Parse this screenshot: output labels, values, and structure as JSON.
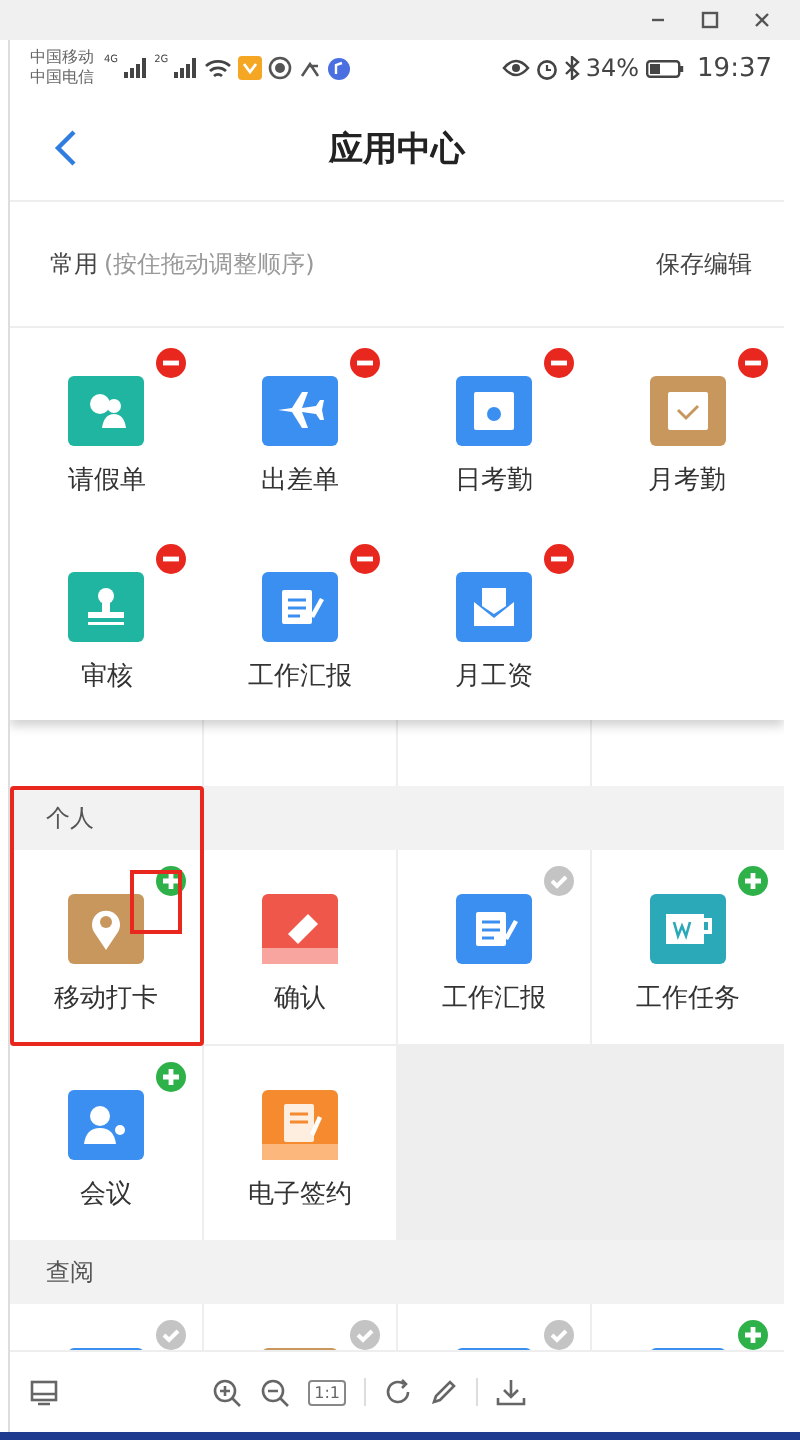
{
  "status_bar": {
    "carriers": [
      "中国移动",
      "中国电信"
    ],
    "networks": [
      "4G",
      "2G"
    ],
    "battery": "34%",
    "time": "19:37"
  },
  "nav": {
    "title": "应用中心"
  },
  "common": {
    "title": "常用",
    "hint": "(按住拖动调整顺序)",
    "action": "保存编辑",
    "apps": [
      {
        "label": "请假单",
        "color": "#1fb5a0",
        "removable": true
      },
      {
        "label": "出差单",
        "color": "#3b8ff0",
        "removable": true
      },
      {
        "label": "日考勤",
        "color": "#3b8ff0",
        "removable": true
      },
      {
        "label": "月考勤",
        "color": "#c8975e",
        "removable": true
      },
      {
        "label": "审核",
        "color": "#1fb5a0",
        "removable": true
      },
      {
        "label": "工作汇报",
        "color": "#3b8ff0",
        "removable": true
      },
      {
        "label": "月工资",
        "color": "#3b8ff0",
        "removable": true
      }
    ]
  },
  "sections": [
    {
      "title": "个人",
      "apps": [
        {
          "label": "移动打卡",
          "color": "#c8975e",
          "addable": true,
          "added": false,
          "highlighted": true
        },
        {
          "label": "确认",
          "color": "#f0574b",
          "addable": false,
          "added": false,
          "highlighted": false
        },
        {
          "label": "工作汇报",
          "color": "#3b8ff0",
          "addable": false,
          "added": true,
          "highlighted": false
        },
        {
          "label": "工作任务",
          "color": "#2ba9b9",
          "addable": true,
          "added": false,
          "highlighted": false
        },
        {
          "label": "会议",
          "color": "#3b8ff0",
          "addable": true,
          "added": false,
          "highlighted": false
        },
        {
          "label": "电子签约",
          "color": "#f58a2e",
          "addable": false,
          "added": false,
          "highlighted": false
        }
      ]
    },
    {
      "title": "查阅",
      "apps": [
        {
          "color": "#3b8ff0",
          "addable": false,
          "added": true,
          "highlighted": false
        },
        {
          "color": "#c8975e",
          "addable": false,
          "added": true,
          "highlighted": false
        },
        {
          "color": "#3b8ff0",
          "addable": false,
          "added": true,
          "highlighted": false
        },
        {
          "color": "#3b8ff0",
          "addable": true,
          "added": false,
          "highlighted": false
        }
      ]
    }
  ],
  "toolbar": {
    "actual_size": "1:1"
  }
}
